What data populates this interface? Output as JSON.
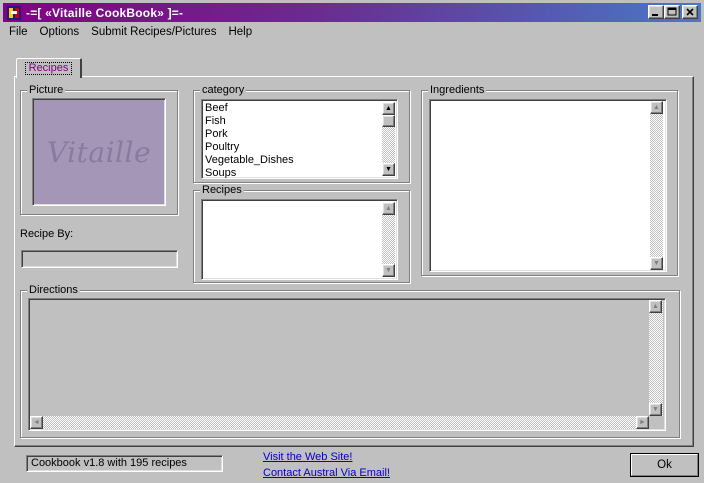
{
  "window": {
    "title": "-=[ «Vitaille CookBook» ]=-",
    "controls": {
      "minimize": "_",
      "maximize": "□",
      "close": "×"
    }
  },
  "menu": [
    "File",
    "Options",
    "Submit Recipes/Pictures",
    "Help"
  ],
  "tabs": [
    {
      "label": "Recipes",
      "selected": true
    }
  ],
  "picture": {
    "label": "Picture",
    "logo_text": "Vitaille"
  },
  "recipe_by": {
    "label": "Recipe By:",
    "value": ""
  },
  "category": {
    "label": "category",
    "items": [
      "Beef",
      "Fish",
      "Pork",
      "Poultry",
      "Vegetable_Dishes",
      "Soups"
    ]
  },
  "recipes": {
    "label": "Recipes",
    "items": []
  },
  "ingredients": {
    "label": "Ingredients",
    "text": ""
  },
  "directions": {
    "label": "Directions",
    "text": ""
  },
  "footer": {
    "status": "Cookbook v1.8 with 195 recipes",
    "link_website": "Visit the Web Site!",
    "link_email": "Contact Austral Via Email!",
    "ok_label": "Ok"
  },
  "icons": {
    "app": "cookbook-app-icon",
    "scroll_up": "▲",
    "scroll_down": "▼",
    "scroll_left": "◄",
    "scroll_right": "►"
  },
  "colors": {
    "title_gradient_start": "#840084",
    "title_gradient_end": "#4878c8",
    "tab_text": "#800080",
    "link": "#0000cc",
    "picture_bg": "#a496b6"
  }
}
